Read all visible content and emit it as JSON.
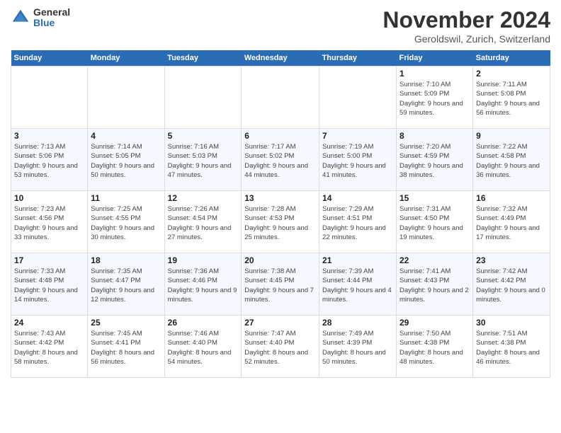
{
  "logo": {
    "general": "General",
    "blue": "Blue"
  },
  "header": {
    "month": "November 2024",
    "location": "Geroldswil, Zurich, Switzerland"
  },
  "weekdays": [
    "Sunday",
    "Monday",
    "Tuesday",
    "Wednesday",
    "Thursday",
    "Friday",
    "Saturday"
  ],
  "weeks": [
    [
      {
        "day": "",
        "info": ""
      },
      {
        "day": "",
        "info": ""
      },
      {
        "day": "",
        "info": ""
      },
      {
        "day": "",
        "info": ""
      },
      {
        "day": "",
        "info": ""
      },
      {
        "day": "1",
        "info": "Sunrise: 7:10 AM\nSunset: 5:09 PM\nDaylight: 9 hours and 59 minutes."
      },
      {
        "day": "2",
        "info": "Sunrise: 7:11 AM\nSunset: 5:08 PM\nDaylight: 9 hours and 56 minutes."
      }
    ],
    [
      {
        "day": "3",
        "info": "Sunrise: 7:13 AM\nSunset: 5:06 PM\nDaylight: 9 hours and 53 minutes."
      },
      {
        "day": "4",
        "info": "Sunrise: 7:14 AM\nSunset: 5:05 PM\nDaylight: 9 hours and 50 minutes."
      },
      {
        "day": "5",
        "info": "Sunrise: 7:16 AM\nSunset: 5:03 PM\nDaylight: 9 hours and 47 minutes."
      },
      {
        "day": "6",
        "info": "Sunrise: 7:17 AM\nSunset: 5:02 PM\nDaylight: 9 hours and 44 minutes."
      },
      {
        "day": "7",
        "info": "Sunrise: 7:19 AM\nSunset: 5:00 PM\nDaylight: 9 hours and 41 minutes."
      },
      {
        "day": "8",
        "info": "Sunrise: 7:20 AM\nSunset: 4:59 PM\nDaylight: 9 hours and 38 minutes."
      },
      {
        "day": "9",
        "info": "Sunrise: 7:22 AM\nSunset: 4:58 PM\nDaylight: 9 hours and 36 minutes."
      }
    ],
    [
      {
        "day": "10",
        "info": "Sunrise: 7:23 AM\nSunset: 4:56 PM\nDaylight: 9 hours and 33 minutes."
      },
      {
        "day": "11",
        "info": "Sunrise: 7:25 AM\nSunset: 4:55 PM\nDaylight: 9 hours and 30 minutes."
      },
      {
        "day": "12",
        "info": "Sunrise: 7:26 AM\nSunset: 4:54 PM\nDaylight: 9 hours and 27 minutes."
      },
      {
        "day": "13",
        "info": "Sunrise: 7:28 AM\nSunset: 4:53 PM\nDaylight: 9 hours and 25 minutes."
      },
      {
        "day": "14",
        "info": "Sunrise: 7:29 AM\nSunset: 4:51 PM\nDaylight: 9 hours and 22 minutes."
      },
      {
        "day": "15",
        "info": "Sunrise: 7:31 AM\nSunset: 4:50 PM\nDaylight: 9 hours and 19 minutes."
      },
      {
        "day": "16",
        "info": "Sunrise: 7:32 AM\nSunset: 4:49 PM\nDaylight: 9 hours and 17 minutes."
      }
    ],
    [
      {
        "day": "17",
        "info": "Sunrise: 7:33 AM\nSunset: 4:48 PM\nDaylight: 9 hours and 14 minutes."
      },
      {
        "day": "18",
        "info": "Sunrise: 7:35 AM\nSunset: 4:47 PM\nDaylight: 9 hours and 12 minutes."
      },
      {
        "day": "19",
        "info": "Sunrise: 7:36 AM\nSunset: 4:46 PM\nDaylight: 9 hours and 9 minutes."
      },
      {
        "day": "20",
        "info": "Sunrise: 7:38 AM\nSunset: 4:45 PM\nDaylight: 9 hours and 7 minutes."
      },
      {
        "day": "21",
        "info": "Sunrise: 7:39 AM\nSunset: 4:44 PM\nDaylight: 9 hours and 4 minutes."
      },
      {
        "day": "22",
        "info": "Sunrise: 7:41 AM\nSunset: 4:43 PM\nDaylight: 9 hours and 2 minutes."
      },
      {
        "day": "23",
        "info": "Sunrise: 7:42 AM\nSunset: 4:42 PM\nDaylight: 9 hours and 0 minutes."
      }
    ],
    [
      {
        "day": "24",
        "info": "Sunrise: 7:43 AM\nSunset: 4:42 PM\nDaylight: 8 hours and 58 minutes."
      },
      {
        "day": "25",
        "info": "Sunrise: 7:45 AM\nSunset: 4:41 PM\nDaylight: 8 hours and 56 minutes."
      },
      {
        "day": "26",
        "info": "Sunrise: 7:46 AM\nSunset: 4:40 PM\nDaylight: 8 hours and 54 minutes."
      },
      {
        "day": "27",
        "info": "Sunrise: 7:47 AM\nSunset: 4:40 PM\nDaylight: 8 hours and 52 minutes."
      },
      {
        "day": "28",
        "info": "Sunrise: 7:49 AM\nSunset: 4:39 PM\nDaylight: 8 hours and 50 minutes."
      },
      {
        "day": "29",
        "info": "Sunrise: 7:50 AM\nSunset: 4:38 PM\nDaylight: 8 hours and 48 minutes."
      },
      {
        "day": "30",
        "info": "Sunrise: 7:51 AM\nSunset: 4:38 PM\nDaylight: 8 hours and 46 minutes."
      }
    ]
  ]
}
